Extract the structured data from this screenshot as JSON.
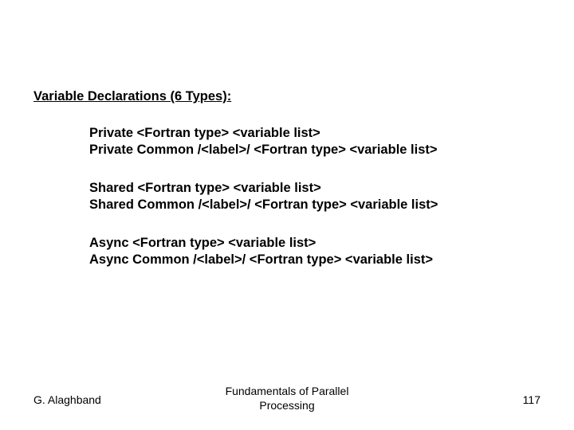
{
  "heading": "Variable Declarations (6 Types):",
  "groups": [
    {
      "l1": "Private <Fortran type> <variable list>",
      "l2": "Private Common /<label>/ <Fortran type> <variable list>"
    },
    {
      "l1": "Shared <Fortran type> <variable list>",
      "l2": "Shared Common /<label>/ <Fortran type> <variable list>"
    },
    {
      "l1": "Async <Fortran type> <variable list>",
      "l2": "Async Common /<label>/ <Fortran type> <variable list>"
    }
  ],
  "footer": {
    "author": "G. Alaghband",
    "title_line1": "Fundamentals of Parallel",
    "title_line2": "Processing",
    "page": "117"
  }
}
